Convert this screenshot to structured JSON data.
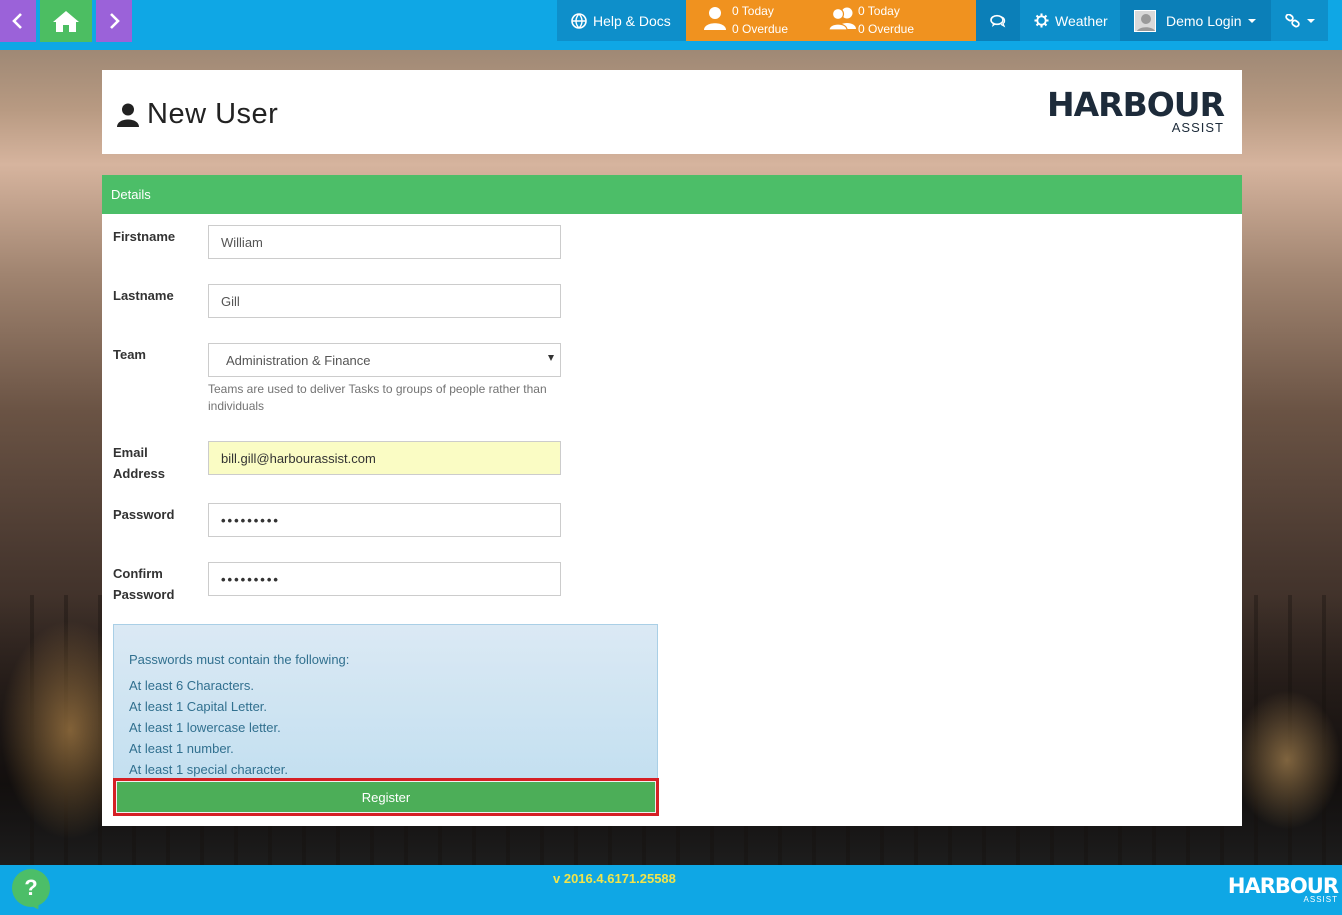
{
  "topbar": {
    "help_label": "Help & Docs",
    "tasks_mine": {
      "today": "0 Today",
      "overdue": "0 Overdue"
    },
    "tasks_team": {
      "today": "0 Today",
      "overdue": "0 Overdue"
    },
    "weather_label": "Weather",
    "user_label": "Demo Login"
  },
  "header": {
    "title": "New User",
    "logo_main": "HARBOUR",
    "logo_sub": "ASSIST"
  },
  "panel": {
    "heading": "Details",
    "firstname": {
      "label": "Firstname",
      "value": "William"
    },
    "lastname": {
      "label": "Lastname",
      "value": "Gill"
    },
    "team": {
      "label": "Team",
      "value": "Administration & Finance",
      "help": "Teams are used to deliver Tasks to groups of people rather than individuals"
    },
    "email": {
      "label_line1": "Email",
      "label_line2": "Address",
      "value": "bill.gill@harbourassist.com"
    },
    "password": {
      "label": "Password",
      "value": "•••••••••"
    },
    "confirm": {
      "label_line1": "Confirm",
      "label_line2": "Password",
      "value": "•••••••••"
    },
    "rules": {
      "intro": "Passwords must contain the following:",
      "items": [
        "At least 6 Characters.",
        "At least 1 Capital Letter.",
        "At least 1 lowercase letter.",
        "At least 1 number.",
        "At least 1 special character."
      ]
    },
    "register_label": "Register"
  },
  "footer": {
    "help_glyph": "?",
    "version": "v 2016.4.6171.25588",
    "logo_main": "HARBOUR",
    "logo_sub": "ASSIST"
  },
  "colors": {
    "topbar": "#0fa7e5",
    "nav_purple": "#9b62d9",
    "nav_green": "#4cbe62",
    "tasks_orange": "#f0921f",
    "panel_heading": "#4cbe68",
    "register": "#4cae58",
    "highlight_border": "#d52025"
  },
  "icons": [
    "chevron-left-icon",
    "home-icon",
    "chevron-right-icon",
    "globe-icon",
    "user-icon",
    "users-icon",
    "chat-icon",
    "gear-icon",
    "avatar",
    "link-icon",
    "user-icon",
    "question-icon"
  ]
}
